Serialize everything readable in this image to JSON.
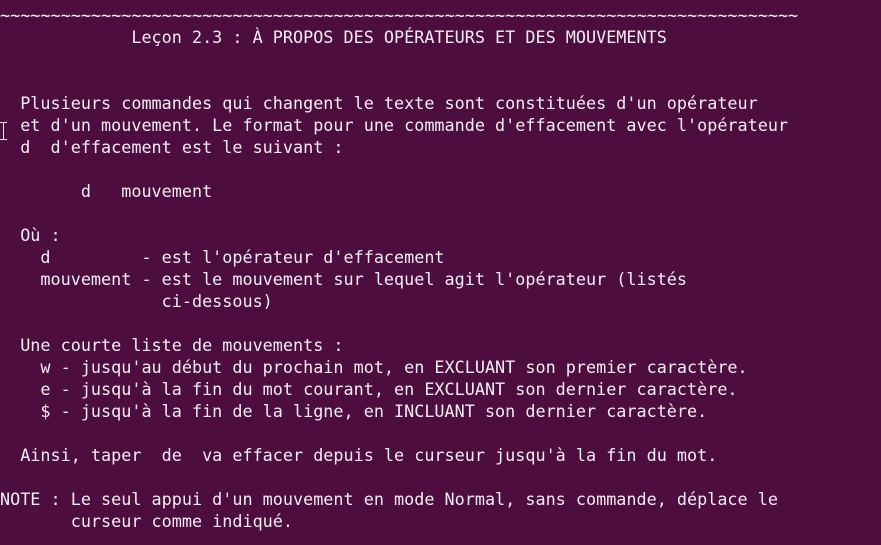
{
  "terminal": {
    "background": "#4d0d3f",
    "foreground": "#f2eef2",
    "lines": {
      "l0": "~~~~~~~~~~~~~~~~~~~~~~~~~~~~~~~~~~~~~~~~~~~~~~~~~~~~~~~~~~~~~~~~~~~~~~~~~~~~~~~",
      "l1": "             Leçon 2.3 : À PROPOS DES OPÉRATEURS ET DES MOUVEMENTS",
      "l2": "",
      "l3": "",
      "l4": "  Plusieurs commandes qui changent le texte sont constituées d'un opérateur",
      "l5": "  et d'un mouvement. Le format pour une commande d'effacement avec l'opérateur",
      "l6": "  d  d'effacement est le suivant :",
      "l7": "",
      "l8": "        d   mouvement",
      "l9": "",
      "l10": "  Où :",
      "l11": "    d         - est l'opérateur d'effacement",
      "l12": "    mouvement - est le mouvement sur lequel agit l'opérateur (listés",
      "l13": "                ci-dessous)",
      "l14": "",
      "l15": "  Une courte liste de mouvements :",
      "l16": "    w - jusqu'au début du prochain mot, en EXCLUANT son premier caractère.",
      "l17": "    e - jusqu'à la fin du mot courant, en EXCLUANT son dernier caractère.",
      "l18": "    $ - jusqu'à la fin de la ligne, en INCLUANT son dernier caractère.",
      "l19": "",
      "l20": "  Ainsi, taper  de  va effacer depuis le curseur jusqu'à la fin du mot.",
      "l21": "",
      "l22": "NOTE : Le seul appui d'un mouvement en mode Normal, sans commande, déplace le",
      "l23": "       curseur comme indiqué."
    },
    "mouse_cursor_icon": "ibeam-cursor-icon"
  }
}
